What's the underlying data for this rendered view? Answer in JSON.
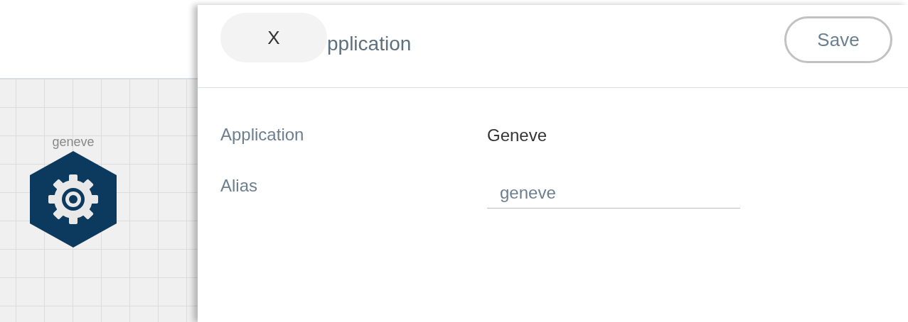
{
  "canvas": {
    "nodes": [
      {
        "label": "geneve"
      }
    ]
  },
  "panel": {
    "close_button": "X",
    "title": "pplication",
    "save_button": "Save",
    "fields": [
      {
        "kind": "text",
        "label": "Application",
        "value": "Geneve"
      },
      {
        "kind": "input",
        "label": "Alias",
        "value": "geneve"
      }
    ]
  }
}
